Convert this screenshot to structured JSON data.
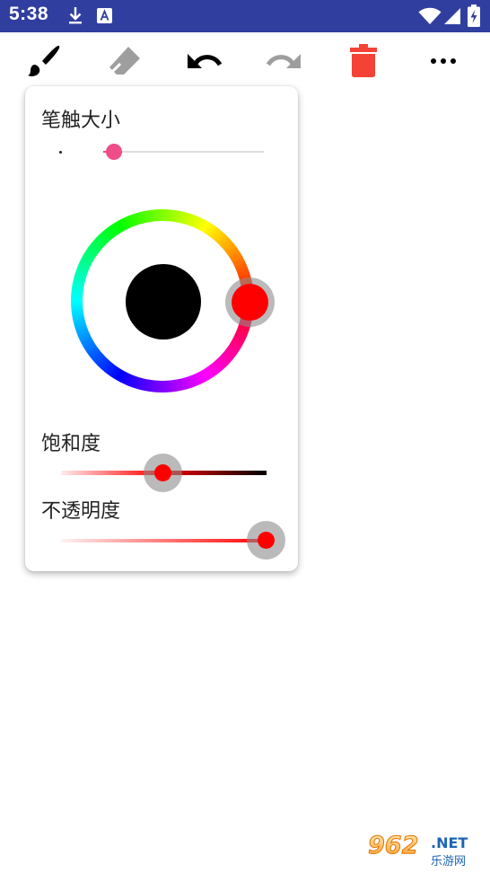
{
  "status_bar": {
    "time": "5:38",
    "bg_color": "#303f9f",
    "left_icons": [
      "download-icon",
      "a-notification-icon"
    ],
    "right_icons": [
      "wifi-icon",
      "cellular-signal-icon",
      "battery-charging-icon"
    ]
  },
  "toolbar": {
    "tools": [
      {
        "name": "brush",
        "icon": "brush-icon",
        "color": "#000000"
      },
      {
        "name": "eraser",
        "icon": "eraser-icon",
        "color": "#9e9e9e"
      },
      {
        "name": "undo",
        "icon": "undo-icon",
        "color": "#000000"
      },
      {
        "name": "redo",
        "icon": "redo-icon",
        "color": "#9e9e9e"
      },
      {
        "name": "delete",
        "icon": "trash-icon",
        "color": "#f44336"
      },
      {
        "name": "more",
        "icon": "more-horizontal-icon",
        "color": "#000000"
      }
    ]
  },
  "brush_panel": {
    "brush_size": {
      "label": "笔触大小",
      "value_fraction": 0.05,
      "accent_color": "#ef4d87"
    },
    "color_wheel": {
      "selected_color": "#ff0000",
      "preview_color": "#000000",
      "hue_degrees": 0
    },
    "saturation": {
      "label": "饱和度",
      "value_fraction": 0.5
    },
    "opacity": {
      "label": "不透明度",
      "value_fraction": 1.0
    }
  },
  "watermark": {
    "text": "962.NET",
    "subtext": "乐游网"
  }
}
